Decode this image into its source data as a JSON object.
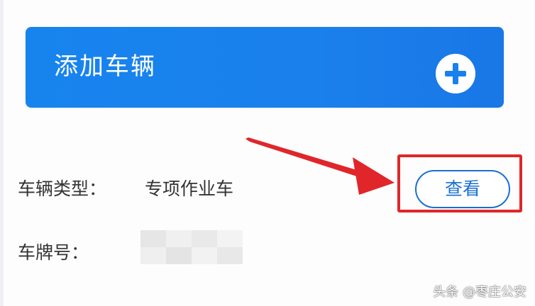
{
  "add_vehicle": {
    "label": "添加车辆",
    "icon": "plus-circle-icon",
    "color": "#1a80ec"
  },
  "vehicle_info": {
    "type_label": "车辆类型：",
    "type_value": "专项作业车",
    "view_button_label": "查看",
    "plate_label": "车牌号："
  },
  "annotation": {
    "highlight_color": "#e0262a",
    "icon": "red-arrow-icon"
  },
  "watermark": {
    "text": "头条 @枣庄公安"
  }
}
